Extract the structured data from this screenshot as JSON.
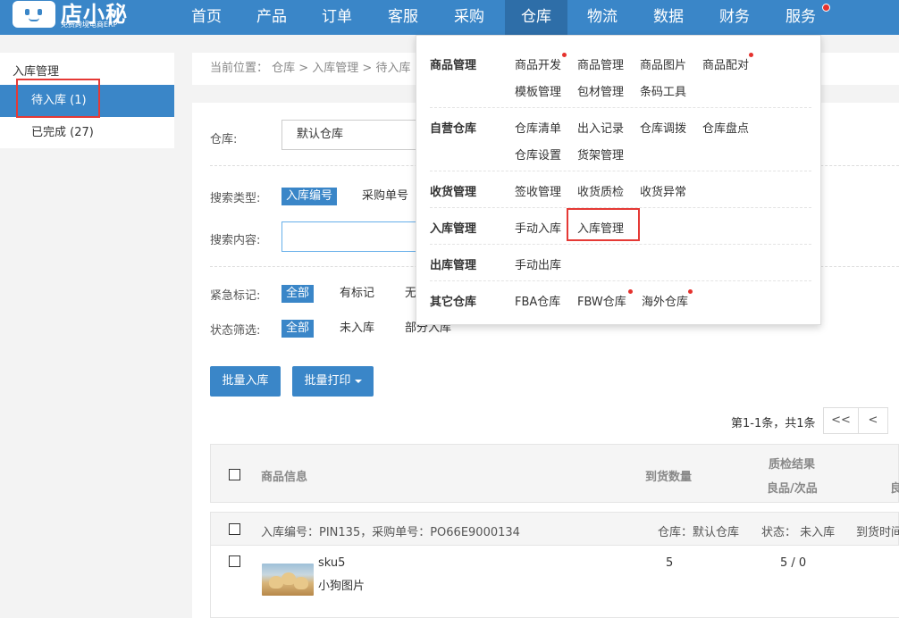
{
  "brand": {
    "name": "店小秘",
    "tagline": "免费跨境电商ERP"
  },
  "nav": {
    "items": [
      "首页",
      "产品",
      "订单",
      "客服",
      "采购",
      "仓库",
      "物流",
      "数据",
      "财务",
      "服务"
    ],
    "active": "仓库"
  },
  "sidebar": {
    "title": "入库管理",
    "items": [
      {
        "label": "待入库 (1)",
        "active": true
      },
      {
        "label": "已完成 (27)",
        "active": false
      }
    ]
  },
  "breadcrumb": "当前位置： 仓库 > 入库管理 > 待入库",
  "filters": {
    "warehouse_label": "仓库:",
    "warehouse_value": "默认仓库",
    "search_type_label": "搜索类型:",
    "search_types": [
      "入库编号",
      "采购单号"
    ],
    "search_content_label": "搜索内容:",
    "search_value": "",
    "urgent_label": "紧急标记:",
    "urgent_options": [
      "全部",
      "有标记",
      "无"
    ],
    "status_label": "状态筛选:",
    "status_options": [
      "全部",
      "未入库",
      "部分入库"
    ]
  },
  "actions": {
    "batch_inbound": "批量入库",
    "batch_print": "批量打印"
  },
  "pager": {
    "summary": "第1-1条，共1条",
    "first": "<<",
    "prev": "<"
  },
  "table": {
    "headers": {
      "product": "商品信息",
      "qty": "到货数量",
      "qc_title": "质检结果",
      "qc_sub": "良品/次品",
      "extra": "良"
    }
  },
  "order": {
    "info": "入库编号：PIN135，采购单号：PO66E9000134",
    "warehouse": "仓库：默认仓库",
    "status": "状态： 未入库",
    "arrival": "到货时间",
    "item": {
      "sku": "sku5",
      "name": "小狗图片",
      "qty": "5",
      "qc": "5 / 0"
    }
  },
  "dropdown": {
    "groups": [
      {
        "category": "商品管理",
        "links": [
          {
            "label": "商品开发",
            "dot": true
          },
          {
            "label": "商品管理",
            "dot": false
          },
          {
            "label": "商品图片",
            "dot": false
          },
          {
            "label": "商品配对",
            "dot": true
          },
          {
            "label": "模板管理",
            "dot": false
          },
          {
            "label": "包材管理",
            "dot": false
          },
          {
            "label": "条码工具",
            "dot": false
          }
        ]
      },
      {
        "category": "自营仓库",
        "links": [
          {
            "label": "仓库清单",
            "dot": false
          },
          {
            "label": "出入记录",
            "dot": false
          },
          {
            "label": "仓库调拨",
            "dot": false
          },
          {
            "label": "仓库盘点",
            "dot": false
          },
          {
            "label": "仓库设置",
            "dot": false
          },
          {
            "label": "货架管理",
            "dot": false
          }
        ]
      },
      {
        "category": "收货管理",
        "links": [
          {
            "label": "签收管理",
            "dot": false
          },
          {
            "label": "收货质检",
            "dot": false
          },
          {
            "label": "收货异常",
            "dot": false
          }
        ]
      },
      {
        "category": "入库管理",
        "links": [
          {
            "label": "手动入库",
            "dot": false
          },
          {
            "label": "入库管理",
            "dot": false,
            "highlighted": true
          }
        ]
      },
      {
        "category": "出库管理",
        "links": [
          {
            "label": "手动出库",
            "dot": false
          }
        ]
      },
      {
        "category": "其它仓库",
        "links": [
          {
            "label": "FBA仓库",
            "dot": false
          },
          {
            "label": "FBW仓库",
            "dot": true
          },
          {
            "label": "海外仓库",
            "dot": true
          }
        ]
      }
    ]
  },
  "colors": {
    "primary": "#3a86c8",
    "nav_active": "#2e6ea8",
    "highlight": "#e53935",
    "dot": "#e5322d"
  }
}
